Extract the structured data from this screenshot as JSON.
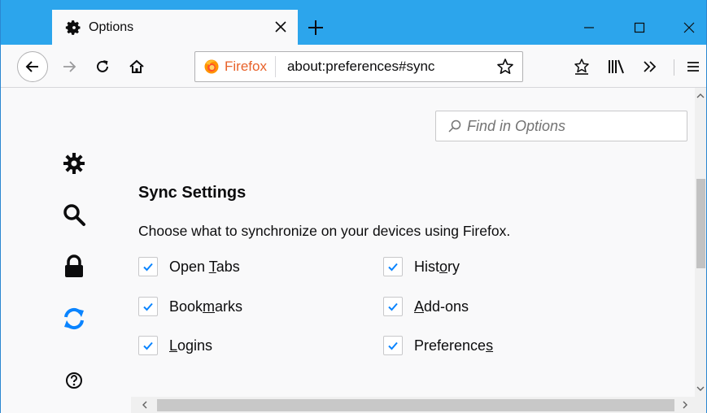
{
  "tab": {
    "title": "Options",
    "icon": "gear-icon",
    "close_icon": "close-icon"
  },
  "window_controls": {
    "minimize_icon": "minimize-icon",
    "maximize_icon": "maximize-icon",
    "close_icon": "close-icon"
  },
  "navbar": {
    "identity_label": "Firefox",
    "url": "about:preferences#sync",
    "icons": [
      "back-arrow-icon",
      "forward-arrow-icon",
      "reload-icon",
      "home-icon",
      "firefox-logo-icon",
      "star-icon",
      "pocket-icon",
      "library-icon",
      "overflow-chevron-icon",
      "hamburger-menu-icon"
    ]
  },
  "search": {
    "placeholder": "Find in Options",
    "icon": "search-icon"
  },
  "categories": [
    {
      "id": "general",
      "icon": "gear-icon"
    },
    {
      "id": "search",
      "icon": "search-icon"
    },
    {
      "id": "privacy",
      "icon": "lock-icon"
    },
    {
      "id": "sync",
      "icon": "sync-icon",
      "selected": true
    },
    {
      "id": "help",
      "icon": "help-icon"
    }
  ],
  "sync": {
    "title": "Sync Settings",
    "description": "Choose what to synchronize on your devices using Firefox.",
    "items": [
      {
        "label_pre": "Open ",
        "label_key": "T",
        "label_post": "abs",
        "checked": true
      },
      {
        "label_pre": "Book",
        "label_key": "m",
        "label_post": "arks",
        "checked": true
      },
      {
        "label_pre": "",
        "label_key": "L",
        "label_post": "ogins",
        "checked": true
      },
      {
        "label_pre": "Hist",
        "label_key": "o",
        "label_post": "ry",
        "checked": true
      },
      {
        "label_pre": "",
        "label_key": "A",
        "label_post": "dd-ons",
        "checked": true
      },
      {
        "label_pre": "Preference",
        "label_key": "s",
        "label_post": "",
        "checked": true
      }
    ]
  },
  "colors": {
    "tab_strip": "#2ca5ec",
    "accent": "#0a84ff",
    "check": "#0a84ff",
    "firefox_label": "#e8622a"
  }
}
